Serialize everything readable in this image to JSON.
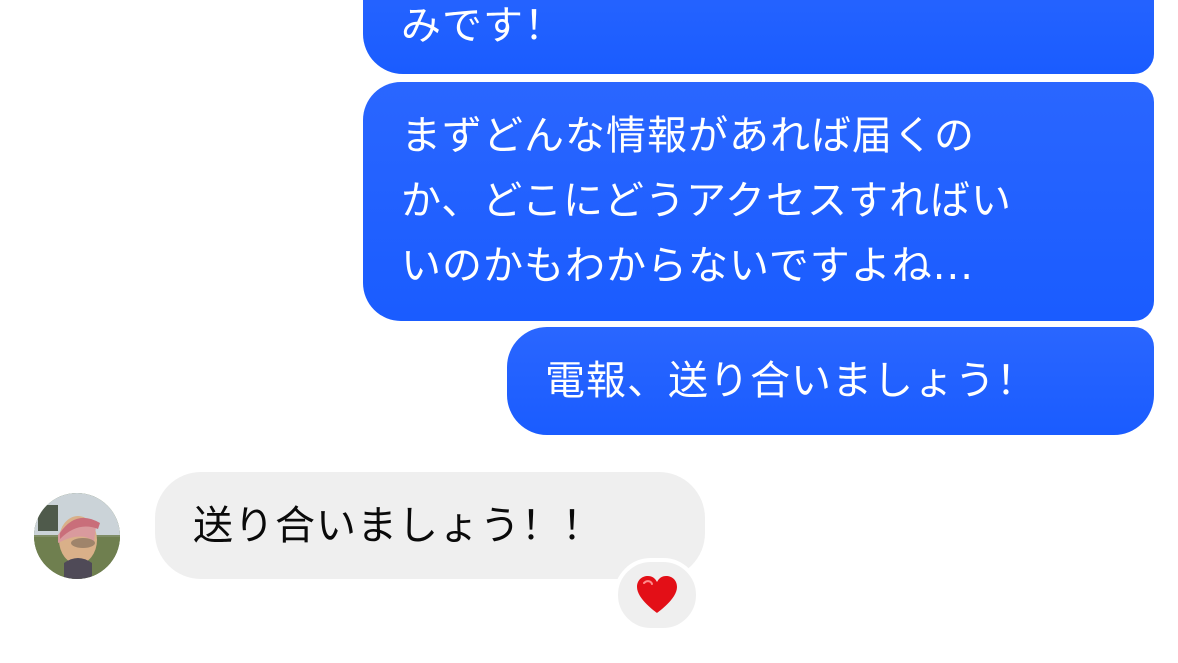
{
  "messages": {
    "outgoing": [
      {
        "lines": [
          "みです！"
        ]
      },
      {
        "lines": [
          "まずどんな情報があれば届くの",
          "か、どこにどうアクセスすればい",
          "いのかもわからないですよね..."
        ]
      },
      {
        "lines": [
          "電報、送り合いましょう！"
        ]
      }
    ],
    "incoming": [
      {
        "lines": [
          "送り合いましょう！！"
        ],
        "reaction": "heart-icon"
      }
    ]
  },
  "colors": {
    "outgoing_bubble": "#1a5cff",
    "incoming_bubble": "#efefef",
    "reaction_heart": "#e30f17",
    "text_on_outgoing": "#ffffff",
    "text_on_incoming": "#0a0a0a"
  }
}
